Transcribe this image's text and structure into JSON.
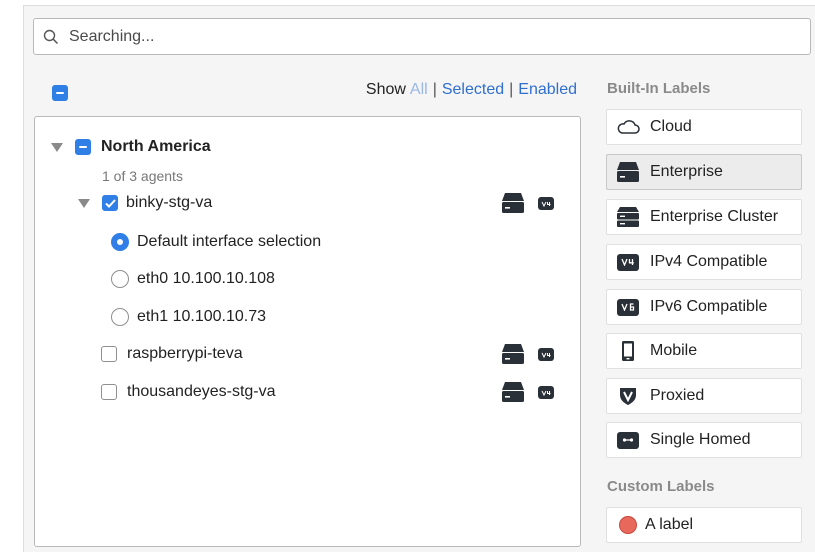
{
  "search": {
    "placeholder": "Searching..."
  },
  "filter": {
    "show_label": "Show",
    "options": [
      "All",
      "Selected",
      "Enabled"
    ],
    "active": "All"
  },
  "tree": {
    "region": {
      "label": "North America",
      "count_text": "1 of 3 agents",
      "agents": [
        {
          "label": "binky-stg-va",
          "checked": true,
          "expanded": true,
          "interfaces": [
            {
              "label": "Default interface selection",
              "selected": true
            },
            {
              "label": "eth0 10.100.10.108",
              "selected": false
            },
            {
              "label": "eth1 10.100.10.73",
              "selected": false
            }
          ]
        },
        {
          "label": "raspberrypi-teva",
          "checked": false
        },
        {
          "label": "thousandeyes-stg-va",
          "checked": false
        }
      ]
    }
  },
  "builtin_labels": {
    "title": "Built-In Labels",
    "items": [
      {
        "label": "Cloud",
        "icon": "cloud-icon",
        "active": false
      },
      {
        "label": "Enterprise",
        "icon": "server-icon",
        "active": true
      },
      {
        "label": "Enterprise Cluster",
        "icon": "server-cluster-icon",
        "active": false
      },
      {
        "label": "IPv4 Compatible",
        "icon": "v4-icon",
        "badge": "V4",
        "active": false
      },
      {
        "label": "IPv6 Compatible",
        "icon": "v6-icon",
        "badge": "V6",
        "active": false
      },
      {
        "label": "Mobile",
        "icon": "mobile-icon",
        "active": false
      },
      {
        "label": "Proxied",
        "icon": "shield-icon",
        "active": false
      },
      {
        "label": "Single Homed",
        "icon": "single-homed-icon",
        "active": false
      }
    ]
  },
  "custom_labels": {
    "title": "Custom Labels",
    "items": [
      {
        "label": "A label",
        "color": "#e8695c"
      }
    ]
  },
  "colors": {
    "accent": "#2f7fe6",
    "dark_icon": "#2a3037",
    "link": "#2f6fd0"
  }
}
